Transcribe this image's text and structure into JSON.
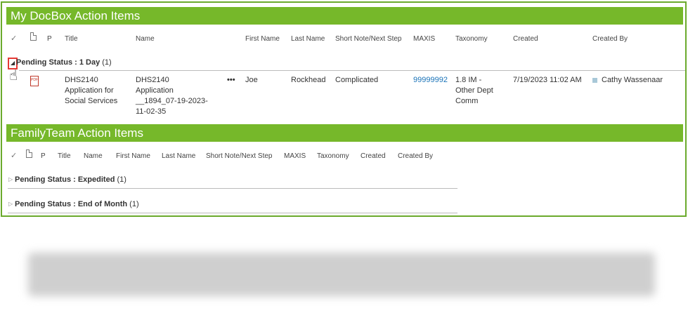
{
  "section1": {
    "title": "My DocBox Action Items",
    "columns": [
      "Title",
      "Name",
      "First Name",
      "Last Name",
      "Short Note/Next Step",
      "MAXIS",
      "Taxonomy",
      "Created",
      "Created By"
    ],
    "p_label": "P",
    "group": {
      "label": "Pending Status",
      "value": "1 Day",
      "count": "(1)"
    },
    "row": {
      "title_lines": [
        "DHS2140",
        "Application for",
        "Social Services"
      ],
      "name_lines": [
        "DHS2140",
        "Application",
        "__1894_07-19-2023-",
        "11-02-35"
      ],
      "menu": "•••",
      "first_name": "Joe",
      "last_name": "Rockhead",
      "note": "Complicated",
      "maxis": "99999992",
      "taxonomy_lines": [
        "1.8 IM -",
        "Other Dept",
        "Comm"
      ],
      "created": "7/19/2023 11:02 AM",
      "created_by": "Cathy Wassenaar"
    }
  },
  "section2": {
    "title": "FamilyTeam Action Items",
    "columns": [
      "Title",
      "Name",
      "First Name",
      "Last Name",
      "Short Note/Next Step",
      "MAXIS",
      "Taxonomy",
      "Created",
      "Created By"
    ],
    "p_label": "P",
    "groups": [
      {
        "label": "Pending Status",
        "value": "Expedited",
        "count": "(1)"
      },
      {
        "label": "Pending Status",
        "value": "End of Month",
        "count": "(1)"
      }
    ]
  },
  "icons": {
    "check": "✓",
    "collapse": "◢",
    "expand": "▷",
    "cursor": "hand-cursor-icon"
  },
  "colors": {
    "header_bar": "#76b82a",
    "border": "#6aaa2c",
    "link": "#1a73b8",
    "highlight": "#e53935"
  }
}
